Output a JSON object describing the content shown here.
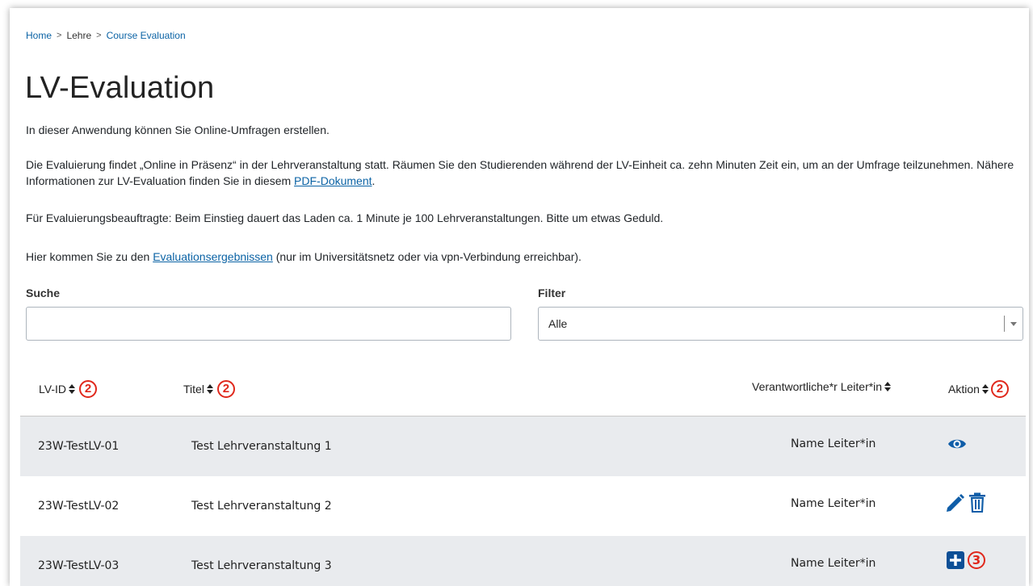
{
  "breadcrumb": {
    "home": "Home",
    "sep": ">",
    "lehre": "Lehre",
    "current": "Course Evaluation"
  },
  "page": {
    "title": "LV-Evaluation",
    "intro": "In dieser Anwendung können Sie Online-Umfragen erstellen.",
    "info_before": "Die Evaluierung findet „Online in Präsenz“ in der Lehrveranstaltung statt. Räumen Sie den Studierenden während der LV-Einheit ca. zehn Minuten Zeit ein, um an der Umfrage teilzunehmen. Nähere Informationen zur LV-Evaluation finden Sie in diesem ",
    "info_link": "PDF-Dokument",
    "info_after": ".",
    "note": "Für Evaluierungsbeauftragte: Beim Einstieg dauert das Laden ca. 1 Minute je 100 Lehrveranstaltungen. Bitte um etwas Geduld.",
    "results_before": "Hier kommen Sie zu den ",
    "results_link": "Evaluationsergebnissen",
    "results_after": " (nur im Universitätsnetz oder via vpn-Verbindung erreichbar)."
  },
  "search": {
    "label": "Suche",
    "value": ""
  },
  "filter": {
    "label": "Filter",
    "value": "Alle"
  },
  "table": {
    "headers": {
      "id": "LV-ID",
      "title": "Titel",
      "leader": "Verantwortliche*r Leiter*in",
      "action": "Aktion"
    },
    "rows": [
      {
        "id": "23W-TestLV-01",
        "title": "Test Lehrveranstaltung 1",
        "leader": "Name Leiter*in",
        "actions": [
          "eye-icon"
        ]
      },
      {
        "id": "23W-TestLV-02",
        "title": "Test Lehrveranstaltung 2",
        "leader": "Name Leiter*in",
        "actions": [
          "pencil-icon",
          "trash-icon"
        ]
      },
      {
        "id": "23W-TestLV-03",
        "title": "Test Lehrveranstaltung 3",
        "leader": "Name Leiter*in",
        "actions": [
          "plus-square-icon"
        ]
      }
    ]
  },
  "annotations": {
    "sort_marker": "2",
    "add_marker": "3"
  },
  "colors": {
    "link": "#0b63a5",
    "icon": "#0f5da8",
    "annotation": "#e0281c",
    "row_shade": "#e9ebee"
  }
}
